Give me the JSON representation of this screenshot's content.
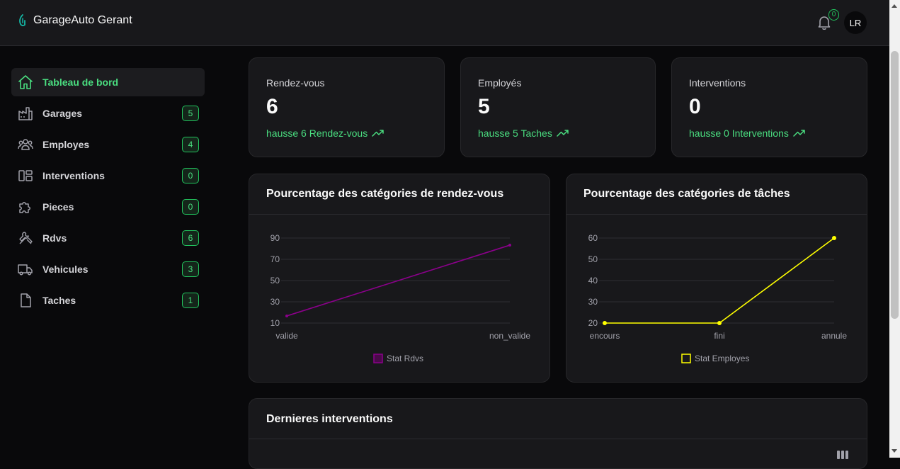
{
  "header": {
    "title": "GarageAuto Gerant",
    "notifications_count": "0",
    "avatar_initials": "LR"
  },
  "sidebar": {
    "items": [
      {
        "label": "Tableau de bord",
        "icon": "home-icon",
        "badge": "",
        "active": true
      },
      {
        "label": "Garages",
        "icon": "factory-icon",
        "badge": "5",
        "active": false
      },
      {
        "label": "Employes",
        "icon": "users-icon",
        "badge": "4",
        "active": false
      },
      {
        "label": "Interventions",
        "icon": "layout-icon",
        "badge": "0",
        "active": false
      },
      {
        "label": "Pieces",
        "icon": "puzzle-icon",
        "badge": "0",
        "active": false
      },
      {
        "label": "Rdvs",
        "icon": "tools-icon",
        "badge": "6",
        "active": false
      },
      {
        "label": "Vehicules",
        "icon": "truck-icon",
        "badge": "3",
        "active": false
      },
      {
        "label": "Taches",
        "icon": "file-icon",
        "badge": "1",
        "active": false
      }
    ]
  },
  "stats": [
    {
      "label": "Rendez-vous",
      "value": "6",
      "trend": "hausse 6 Rendez-vous"
    },
    {
      "label": "Employés",
      "value": "5",
      "trend": "hausse 5 Taches"
    },
    {
      "label": "Interventions",
      "value": "0",
      "trend": "hausse 0 Interventions"
    }
  ],
  "chart_data": [
    {
      "type": "line",
      "title": "Pourcentage des catégories de rendez-vous",
      "categories": [
        "valide",
        "non_valide"
      ],
      "series": [
        {
          "name": "Stat Rdvs",
          "values": [
            16.7,
            83.3
          ]
        }
      ],
      "yticks": [
        10,
        30,
        50,
        70,
        90
      ],
      "ylim": [
        10,
        90
      ],
      "color": "#8b008b",
      "legend": "bottom"
    },
    {
      "type": "line",
      "title": "Pourcentage des catégories de tâches",
      "categories": [
        "encours",
        "fini",
        "annule"
      ],
      "series": [
        {
          "name": "Stat Employes",
          "values": [
            20,
            20,
            60
          ]
        }
      ],
      "yticks": [
        20,
        30,
        40,
        50,
        60
      ],
      "ylim": [
        20,
        60
      ],
      "color": "#ffff00",
      "legend": "bottom"
    }
  ],
  "recent": {
    "title": "Dernieres interventions",
    "columns_icon": "columns-icon"
  },
  "colors": {
    "accent": "#22c55e",
    "background": "#09090b",
    "card": "#18181b"
  }
}
